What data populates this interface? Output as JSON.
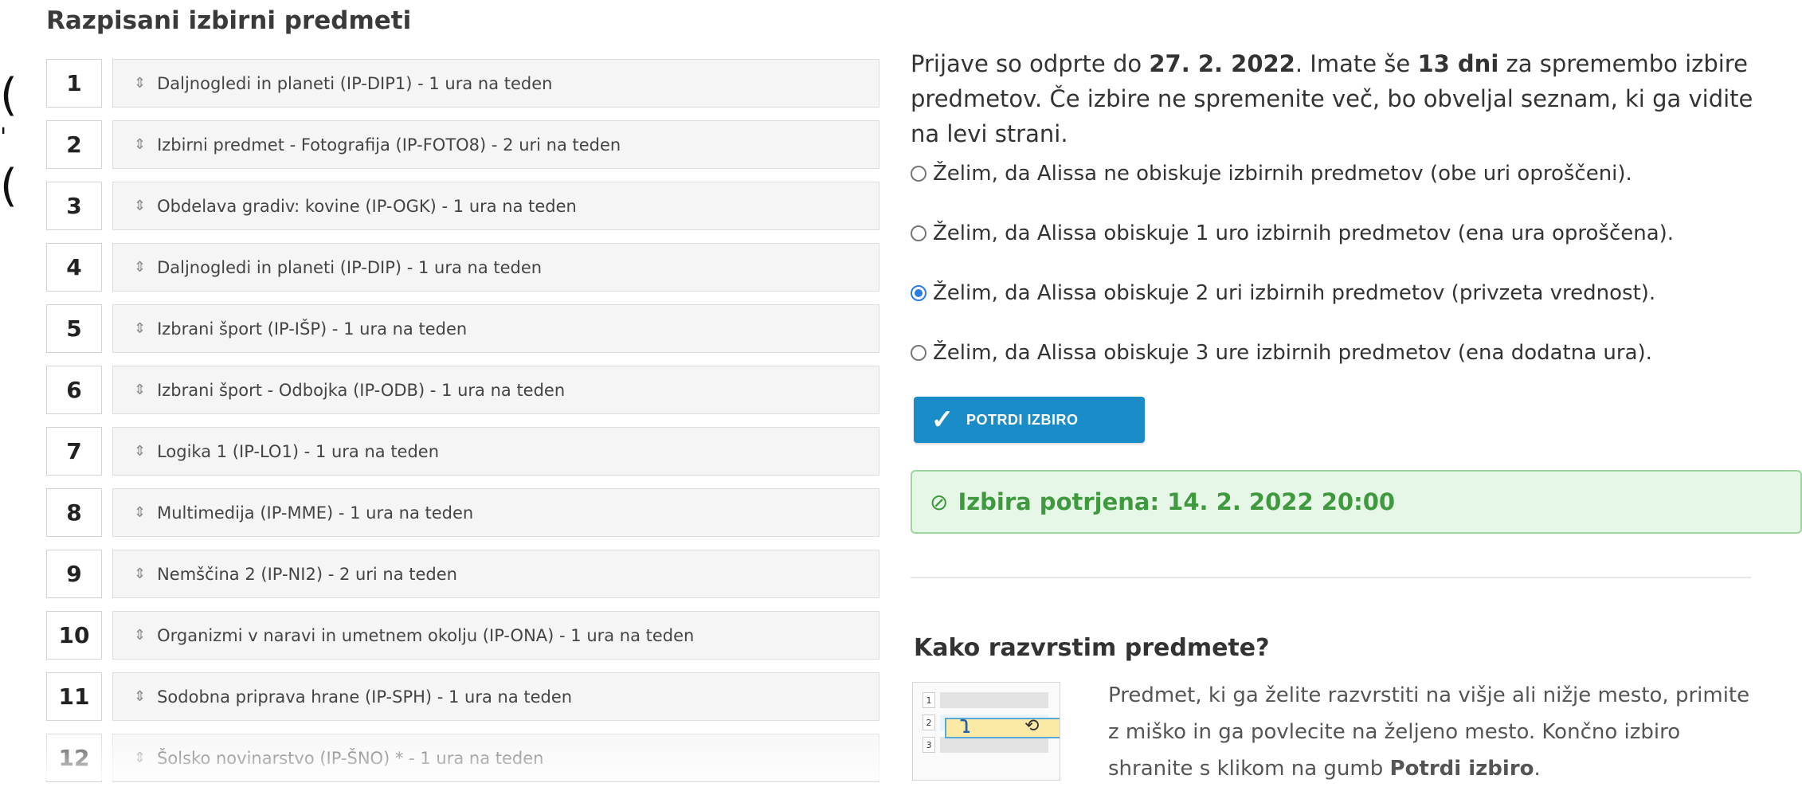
{
  "subjects": {
    "title": "Razpisani izbirni predmeti",
    "items": [
      {
        "num": "1",
        "label": "Daljnogledi in planeti (IP-DIP1) - 1 ura na teden"
      },
      {
        "num": "2",
        "label": "Izbirni predmet - Fotografija (IP-FOTO8) - 2 uri na teden"
      },
      {
        "num": "3",
        "label": "Obdelava gradiv: kovine (IP-OGK) - 1 ura na teden"
      },
      {
        "num": "4",
        "label": "Daljnogledi in planeti (IP-DIP) - 1 ura na teden"
      },
      {
        "num": "5",
        "label": "Izbrani šport (IP-IŠP) - 1 ura na teden"
      },
      {
        "num": "6",
        "label": "Izbrani šport - Odbojka (IP-ODB) - 1 ura na teden"
      },
      {
        "num": "7",
        "label": "Logika 1 (IP-LO1) - 1 ura na teden"
      },
      {
        "num": "8",
        "label": "Multimedija (IP-MME) - 1 ura na teden"
      },
      {
        "num": "9",
        "label": "Nemščina 2 (IP-NI2) - 2 uri na teden"
      },
      {
        "num": "10",
        "label": "Organizmi v naravi in umetnem okolju (IP-ONA) - 1 ura na teden"
      },
      {
        "num": "11",
        "label": "Sodobna priprava hrane (IP-SPH) - 1 ura na teden"
      },
      {
        "num": "12",
        "label": "Šolsko novinarstvo (IP-ŠNO) * - 1 ura na teden"
      }
    ],
    "drag_glyph": "⇕"
  },
  "edge_glyphs": [
    "(",
    "'",
    "("
  ],
  "info": {
    "intro_1": "Prijave so odprte do ",
    "deadline": "27. 2. 2022",
    "intro_2": ". Imate še ",
    "days": "13 dni",
    "intro_3": " za spremembo izbire predmetov. Če izbire ne spremenite več, bo obveljal seznam, ki ga vidite na levi strani."
  },
  "options": [
    {
      "label": "Želim, da Alissa ne obiskuje izbirnih predmetov (obe uri oproščeni).",
      "selected": false
    },
    {
      "label": "Želim, da Alissa obiskuje 1 uro izbirnih predmetov (ena ura oproščena).",
      "selected": false
    },
    {
      "label": "Želim, da Alissa obiskuje 2 uri izbirnih predmetov (privzeta vrednost).",
      "selected": true
    },
    {
      "label": "Želim, da Alissa obiskuje 3 ure izbirnih predmetov (ena dodatna ura).",
      "selected": false
    }
  ],
  "confirm_button": {
    "label": "POTRDI IZBIRO",
    "icon": "checkmark-icon",
    "color": "#1a8cc8"
  },
  "alert": {
    "icon": "check-circle-icon",
    "text": "Izbira potrjena: 14. 2. 2022 20:00",
    "color": "#3f9a3f"
  },
  "help": {
    "title": "Kako razvrstim predmete?",
    "text_1": "Predmet, ki ga želite razvrstiti na višje ali nižje mesto, primite z miško in ga povlecite na željeno mesto. Končno izbiro shranite s klikom na gumb ",
    "text_bold": "Potrdi izbiro",
    "text_2": ".",
    "illustration_nums": [
      "1",
      "2",
      "3"
    ]
  }
}
